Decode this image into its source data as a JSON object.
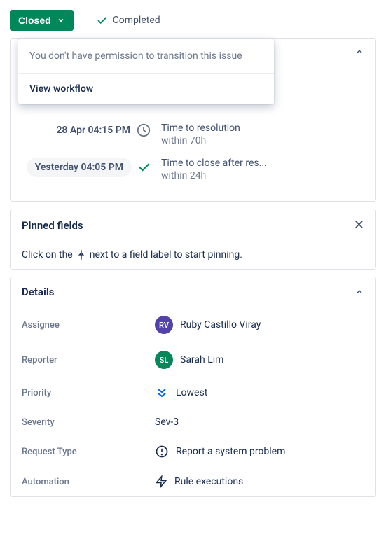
{
  "status": {
    "button_label": "Closed",
    "resolution_label": "Completed"
  },
  "dropdown": {
    "permission_text": "You don't have permission to transition this issue",
    "view_workflow": "View workflow"
  },
  "sla": {
    "items": [
      {
        "time": "28 Apr 04:15 PM",
        "icon": "clock",
        "name": "Time to resolution",
        "within": "within 70h",
        "pill": false
      },
      {
        "time": "Yesterday 04:05 PM",
        "icon": "check",
        "name": "Time to close after res...",
        "within": "within 24h",
        "pill": true
      }
    ]
  },
  "pinned": {
    "title": "Pinned fields",
    "hint_prefix": "Click on the",
    "hint_suffix": "next to a field label to start pinning."
  },
  "details": {
    "title": "Details",
    "fields": {
      "assignee": {
        "label": "Assignee",
        "value": "Ruby Castillo Viray",
        "initials": "RV",
        "avatar_color": "purple"
      },
      "reporter": {
        "label": "Reporter",
        "value": "Sarah Lim",
        "initials": "SL",
        "avatar_color": "green"
      },
      "priority": {
        "label": "Priority",
        "value": "Lowest"
      },
      "severity": {
        "label": "Severity",
        "value": "Sev-3"
      },
      "request_type": {
        "label": "Request Type",
        "value": "Report a system problem"
      },
      "automation": {
        "label": "Automation",
        "value": "Rule executions"
      }
    }
  }
}
